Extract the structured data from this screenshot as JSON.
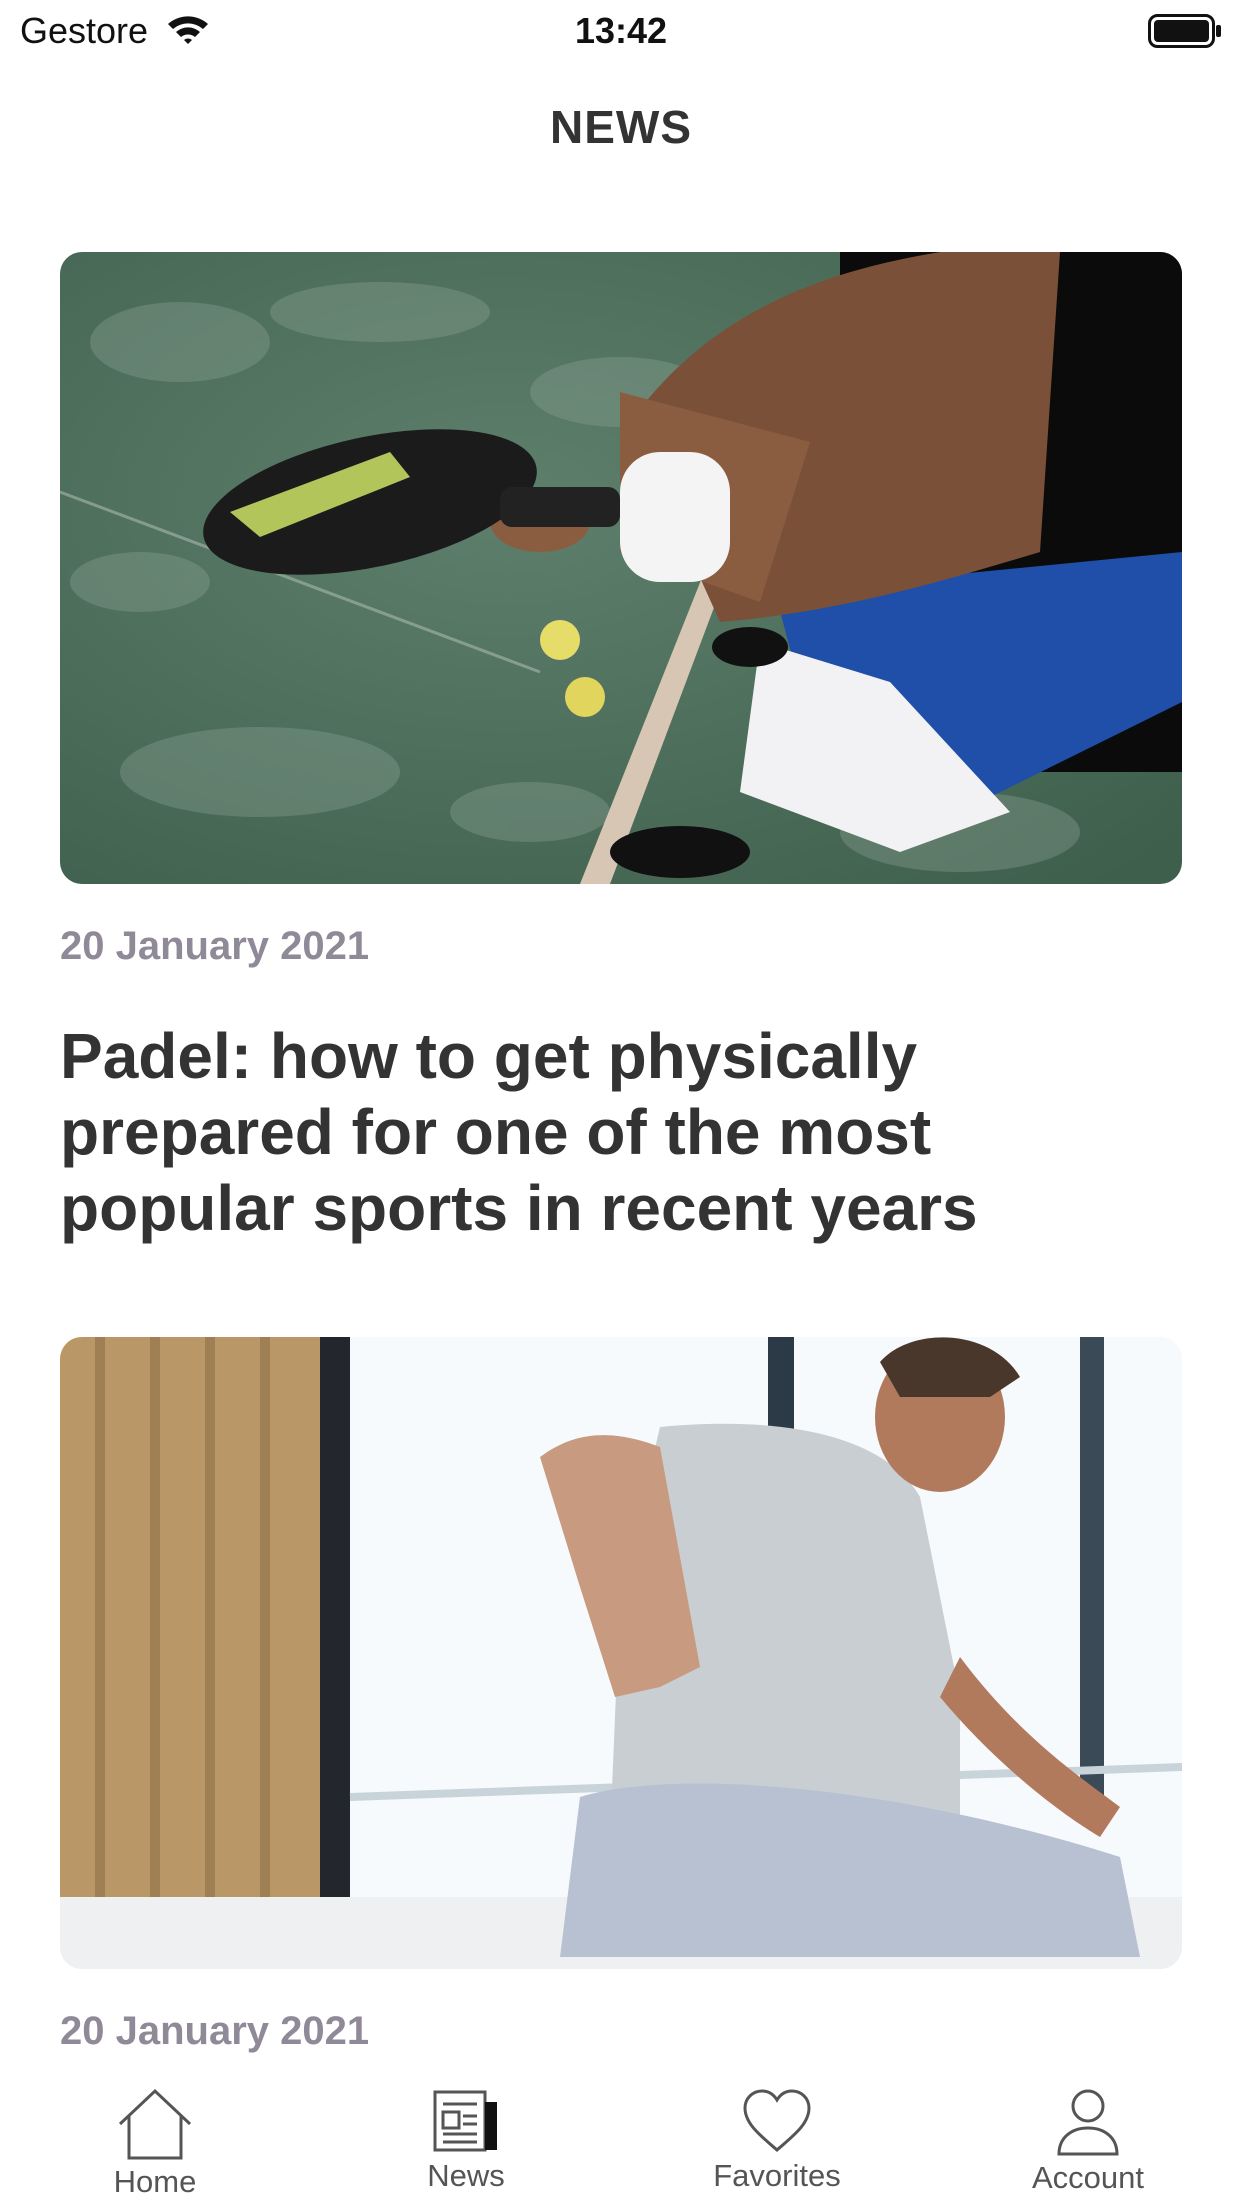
{
  "status_bar": {
    "carrier": "Gestore",
    "time": "13:42"
  },
  "header": {
    "title": "NEWS"
  },
  "articles": [
    {
      "date": "20 January 2021",
      "title": "Padel: how to get physically prepared for one of the most popular sports in recent years",
      "image": "padel-player-photo"
    },
    {
      "date": "20 January 2021",
      "image": "man-back-pain-photo"
    }
  ],
  "tab_bar": {
    "items": [
      {
        "label": "Home",
        "icon": "home-icon"
      },
      {
        "label": "News",
        "icon": "newspaper-icon"
      },
      {
        "label": "Favorites",
        "icon": "heart-icon"
      },
      {
        "label": "Account",
        "icon": "person-icon"
      }
    ]
  }
}
